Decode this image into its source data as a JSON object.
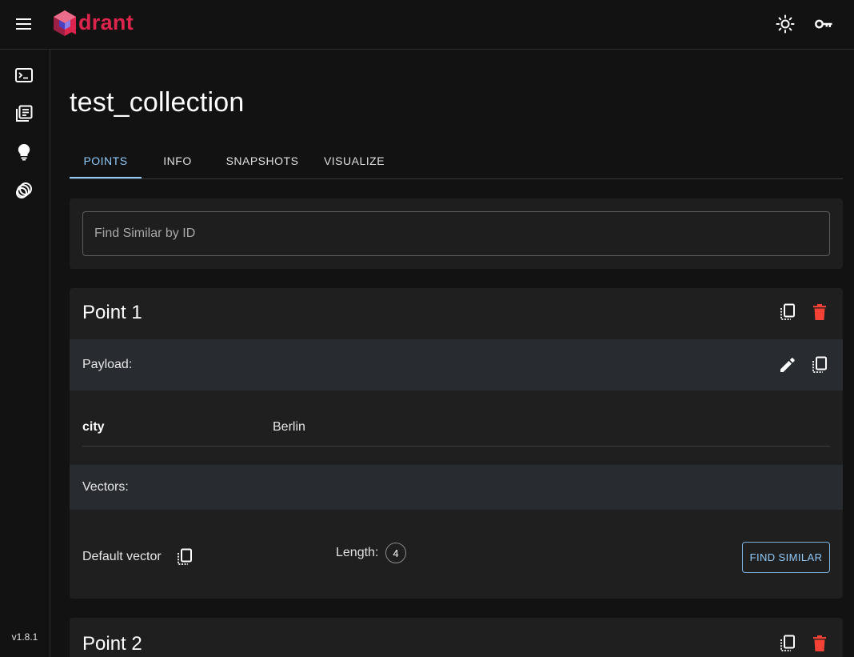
{
  "header": {
    "brand_text": "drant",
    "menu_icon": "hamburger-menu-icon",
    "theme_icon": "sun-icon",
    "api_key_icon": "key-icon"
  },
  "sidebar": {
    "items": [
      {
        "icon": "console-icon"
      },
      {
        "icon": "collections-icon"
      },
      {
        "icon": "lightbulb-icon"
      },
      {
        "icon": "datasets-icon"
      }
    ],
    "version": "v1.8.1"
  },
  "page": {
    "title": "test_collection",
    "tabs": [
      {
        "label": "POINTS",
        "active": true
      },
      {
        "label": "INFO",
        "active": false
      },
      {
        "label": "SNAPSHOTS",
        "active": false
      },
      {
        "label": "VISUALIZE",
        "active": false
      }
    ],
    "search": {
      "placeholder": "Find Similar by ID",
      "value": ""
    }
  },
  "points": [
    {
      "title": "Point 1",
      "payload_label": "Payload:",
      "payload": [
        {
          "key": "city",
          "value": "Berlin"
        }
      ],
      "vectors_label": "Vectors:",
      "vector": {
        "name": "Default vector",
        "length_label": "Length:",
        "length": "4",
        "button_label": "FIND SIMILAR"
      }
    },
    {
      "title": "Point 2"
    }
  ],
  "colors": {
    "accent": "#90caf9",
    "brand": "#dc244c",
    "delete": "#f44336",
    "background": "#121212",
    "card": "#1f1f1f",
    "section": "#282c30"
  }
}
